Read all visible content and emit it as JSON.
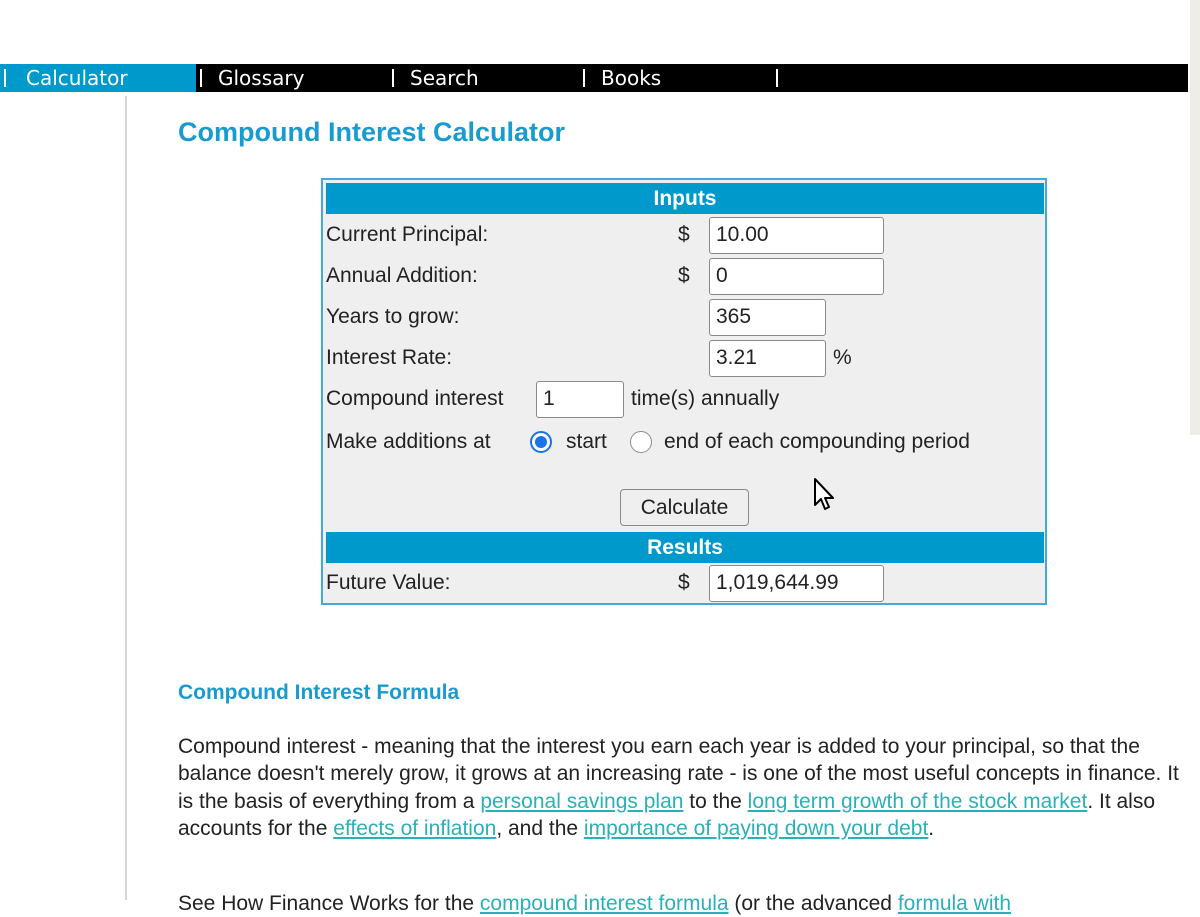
{
  "nav": {
    "items": [
      {
        "label": "Calculator",
        "active": true
      },
      {
        "label": "Glossary",
        "active": false
      },
      {
        "label": "Search",
        "active": false
      },
      {
        "label": "Books",
        "active": false
      }
    ]
  },
  "page": {
    "title": "Compound Interest Calculator"
  },
  "calculator": {
    "inputs_header": "Inputs",
    "results_header": "Results",
    "currency_symbol": "$",
    "percent_symbol": "%",
    "principal": {
      "label": "Current Principal:",
      "value": "10.00"
    },
    "annual_addition": {
      "label": "Annual Addition:",
      "value": "0"
    },
    "years": {
      "label": "Years to grow:",
      "value": "365"
    },
    "rate": {
      "label": "Interest Rate:",
      "value": "3.21"
    },
    "compound": {
      "label_before": "Compound interest",
      "value": "1",
      "label_after": "time(s) annually"
    },
    "additions": {
      "label": "Make additions at",
      "options": [
        {
          "label": "start",
          "checked": true
        },
        {
          "label": "end of each compounding period",
          "checked": false
        }
      ]
    },
    "calculate_label": "Calculate",
    "future_value": {
      "label": "Future Value:",
      "value": "1,019,644.99"
    }
  },
  "article": {
    "heading": "Compound Interest Formula",
    "p1": {
      "t1": "Compound interest - meaning that the interest you earn each year is added to your principal, so that the balance doesn't merely grow, it grows at an increasing rate - is one of the most useful concepts in finance. It is the basis of everything from a ",
      "link1": "personal savings plan",
      "t2": " to the ",
      "link2": "long term growth of the stock market",
      "t3": ". It also accounts for the ",
      "link3": "effects of inflation",
      "t4": ", and the ",
      "link4": "importance of paying down your debt",
      "t5": "."
    },
    "p2": {
      "t1": "See How Finance Works for the ",
      "link1": "compound interest formula",
      "t2": " (or the advanced ",
      "link2": "formula with"
    }
  }
}
